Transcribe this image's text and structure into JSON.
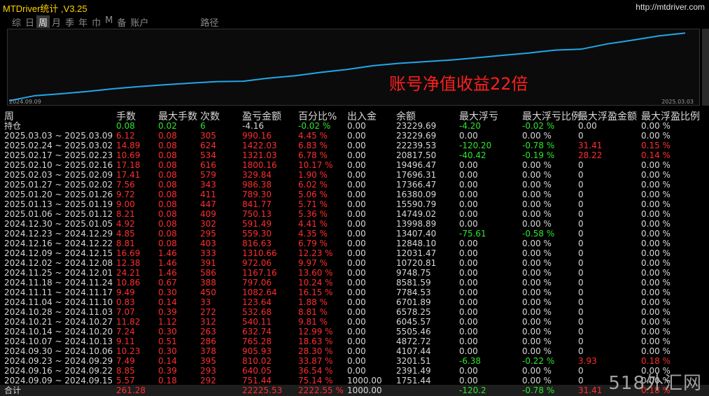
{
  "title": "MTDriver统计 ,V3.25",
  "site": "http://mtdriver.com",
  "tabs": [
    "综",
    "日",
    "周",
    "月",
    "季",
    "年",
    "巾",
    "M",
    "备",
    "账户",
    "路径"
  ],
  "active_tab": 2,
  "annotation": "账号净值收益22倍",
  "chart_data": {
    "type": "line",
    "x_start_label": "2024.09.09",
    "x_end_label": "2025.03.03",
    "series": [
      {
        "values": [
          0,
          1751.44,
          2391.49,
          3201.51,
          4107.44,
          4872.72,
          5505.46,
          6045.57,
          6578.25,
          6701.89,
          7784.53,
          8581.59,
          9748.75,
          10720.81,
          12031.47,
          12848.1,
          13407.4,
          13998.89,
          14749.02,
          15590.79,
          16380.09,
          17366.47,
          17696.31,
          19496.47,
          20817.5,
          22239.53,
          23229.69
        ]
      }
    ],
    "ylim": [
      0,
      24000
    ],
    "line_color": "#1fa8e8"
  },
  "columns": [
    "周",
    "手数",
    "最大手数",
    "次数",
    "盈亏金额",
    "百分比%",
    "出入金",
    "余额",
    "最大浮亏",
    "最大浮亏比例",
    "最大浮盈金额",
    "最大浮盈比例"
  ],
  "rows": [
    {
      "week": "持仓",
      "lots": "0.08",
      "maxlot": "0.02",
      "count": "6",
      "pl": "-4.16",
      "pct": "-0.02 %",
      "io": "0.00",
      "bal": "23229.69",
      "maxdd": "-4.20",
      "maxddp": "-0.02 %",
      "maxfp": "0.00",
      "maxfpp": "0.00 %",
      "color": "green"
    },
    {
      "week": "2025.03.03 ~ 2025.03.09",
      "lots": "6.12",
      "maxlot": "0.08",
      "count": "305",
      "pl": "990.16",
      "pct": "4.45 %",
      "io": "0.00",
      "bal": "23229.69",
      "maxdd": "0.00",
      "maxddp": "0.00 %",
      "maxfp": "0",
      "maxfpp": "0.00 %",
      "color": "red"
    },
    {
      "week": "2025.02.24 ~ 2025.03.02",
      "lots": "14.89",
      "maxlot": "0.08",
      "count": "624",
      "pl": "1422.03",
      "pct": "6.83 %",
      "io": "0.00",
      "bal": "22239.53",
      "maxdd": "-120.20",
      "maxddp": "-0.78 %",
      "maxfp": "31.41",
      "maxfpp": "0.15 %",
      "color": "red"
    },
    {
      "week": "2025.02.17 ~ 2025.02.23",
      "lots": "10.69",
      "maxlot": "0.08",
      "count": "534",
      "pl": "1321.03",
      "pct": "6.78 %",
      "io": "0.00",
      "bal": "20817.50",
      "maxdd": "-40.42",
      "maxddp": "-0.19 %",
      "maxfp": "28.22",
      "maxfpp": "0.14 %",
      "color": "red"
    },
    {
      "week": "2025.02.10 ~ 2025.02.16",
      "lots": "17.18",
      "maxlot": "0.08",
      "count": "616",
      "pl": "1800.16",
      "pct": "10.17 %",
      "io": "0.00",
      "bal": "19496.47",
      "maxdd": "0.00",
      "maxddp": "0.00 %",
      "maxfp": "0",
      "maxfpp": "0.00 %",
      "color": "red"
    },
    {
      "week": "2025.02.03 ~ 2025.02.09",
      "lots": "17.41",
      "maxlot": "0.08",
      "count": "579",
      "pl": "329.84",
      "pct": "1.90 %",
      "io": "0.00",
      "bal": "17696.31",
      "maxdd": "0.00",
      "maxddp": "0.00 %",
      "maxfp": "0",
      "maxfpp": "0.00 %",
      "color": "red"
    },
    {
      "week": "2025.01.27 ~ 2025.02.02",
      "lots": "7.56",
      "maxlot": "0.08",
      "count": "343",
      "pl": "986.38",
      "pct": "6.02 %",
      "io": "0.00",
      "bal": "17366.47",
      "maxdd": "0.00",
      "maxddp": "0.00 %",
      "maxfp": "0",
      "maxfpp": "0.00 %",
      "color": "red"
    },
    {
      "week": "2025.01.20 ~ 2025.01.26",
      "lots": "9.72",
      "maxlot": "0.08",
      "count": "411",
      "pl": "789.30",
      "pct": "5.06 %",
      "io": "0.00",
      "bal": "16380.09",
      "maxdd": "0.00",
      "maxddp": "0.00 %",
      "maxfp": "0",
      "maxfpp": "0.00 %",
      "color": "red"
    },
    {
      "week": "2025.01.13 ~ 2025.01.19",
      "lots": "9.00",
      "maxlot": "0.08",
      "count": "447",
      "pl": "841.77",
      "pct": "5.71 %",
      "io": "0.00",
      "bal": "15590.79",
      "maxdd": "0.00",
      "maxddp": "0.00 %",
      "maxfp": "0",
      "maxfpp": "0.00 %",
      "color": "red"
    },
    {
      "week": "2025.01.06 ~ 2025.01.12",
      "lots": "8.21",
      "maxlot": "0.08",
      "count": "409",
      "pl": "750.13",
      "pct": "5.36 %",
      "io": "0.00",
      "bal": "14749.02",
      "maxdd": "0.00",
      "maxddp": "0.00 %",
      "maxfp": "0",
      "maxfpp": "0.00 %",
      "color": "red"
    },
    {
      "week": "2024.12.30 ~ 2025.01.05",
      "lots": "4.92",
      "maxlot": "0.08",
      "count": "302",
      "pl": "591.49",
      "pct": "4.41 %",
      "io": "0.00",
      "bal": "13998.89",
      "maxdd": "0.00",
      "maxddp": "0.00 %",
      "maxfp": "0",
      "maxfpp": "0.00 %",
      "color": "red"
    },
    {
      "week": "2024.12.23 ~ 2024.12.29",
      "lots": "4.85",
      "maxlot": "0.08",
      "count": "295",
      "pl": "559.30",
      "pct": "4.35 %",
      "io": "0.00",
      "bal": "13407.40",
      "maxdd": "-75.61",
      "maxddp": "-0.58 %",
      "maxfp": "0",
      "maxfpp": "0.00 %",
      "color": "red"
    },
    {
      "week": "2024.12.16 ~ 2024.12.22",
      "lots": "8.81",
      "maxlot": "0.08",
      "count": "403",
      "pl": "816.63",
      "pct": "6.79 %",
      "io": "0.00",
      "bal": "12848.10",
      "maxdd": "0.00",
      "maxddp": "0.00 %",
      "maxfp": "0",
      "maxfpp": "0.00 %",
      "color": "red"
    },
    {
      "week": "2024.12.09 ~ 2024.12.15",
      "lots": "16.69",
      "maxlot": "1.46",
      "count": "333",
      "pl": "1310.66",
      "pct": "12.23 %",
      "io": "0.00",
      "bal": "12031.47",
      "maxdd": "0.00",
      "maxddp": "0.00 %",
      "maxfp": "0",
      "maxfpp": "0.00 %",
      "color": "red"
    },
    {
      "week": "2024.12.02 ~ 2024.12.08",
      "lots": "12.38",
      "maxlot": "1.46",
      "count": "391",
      "pl": "972.06",
      "pct": "9.97 %",
      "io": "0.00",
      "bal": "10720.81",
      "maxdd": "0.00",
      "maxddp": "0.00 %",
      "maxfp": "0",
      "maxfpp": "0.00 %",
      "color": "red"
    },
    {
      "week": "2024.11.25 ~ 2024.12.01",
      "lots": "24.21",
      "maxlot": "1.46",
      "count": "586",
      "pl": "1167.16",
      "pct": "13.60 %",
      "io": "0.00",
      "bal": "9748.75",
      "maxdd": "0.00",
      "maxddp": "0.00 %",
      "maxfp": "0",
      "maxfpp": "0.00 %",
      "color": "red"
    },
    {
      "week": "2024.11.18 ~ 2024.11.24",
      "lots": "10.86",
      "maxlot": "0.67",
      "count": "388",
      "pl": "797.06",
      "pct": "10.24 %",
      "io": "0.00",
      "bal": "8581.59",
      "maxdd": "0.00",
      "maxddp": "0.00 %",
      "maxfp": "0",
      "maxfpp": "0.00 %",
      "color": "red"
    },
    {
      "week": "2024.11.11 ~ 2024.11.17",
      "lots": "9.49",
      "maxlot": "0.30",
      "count": "450",
      "pl": "1082.64",
      "pct": "16.15 %",
      "io": "0.00",
      "bal": "7784.53",
      "maxdd": "0.00",
      "maxddp": "0.00 %",
      "maxfp": "0",
      "maxfpp": "0.00 %",
      "color": "red"
    },
    {
      "week": "2024.11.04 ~ 2024.11.10",
      "lots": "0.83",
      "maxlot": "0.14",
      "count": "33",
      "pl": "123.64",
      "pct": "1.88 %",
      "io": "0.00",
      "bal": "6701.89",
      "maxdd": "0.00",
      "maxddp": "0.00 %",
      "maxfp": "0",
      "maxfpp": "0.00 %",
      "color": "red"
    },
    {
      "week": "2024.10.28 ~ 2024.11.03",
      "lots": "7.07",
      "maxlot": "0.39",
      "count": "272",
      "pl": "532.68",
      "pct": "8.81 %",
      "io": "0.00",
      "bal": "6578.25",
      "maxdd": "0.00",
      "maxddp": "0.00 %",
      "maxfp": "0",
      "maxfpp": "0.00 %",
      "color": "red"
    },
    {
      "week": "2024.10.21 ~ 2024.10.27",
      "lots": "11.82",
      "maxlot": "1.12",
      "count": "312",
      "pl": "540.11",
      "pct": "9.81 %",
      "io": "0.00",
      "bal": "6045.57",
      "maxdd": "0.00",
      "maxddp": "0.00 %",
      "maxfp": "0",
      "maxfpp": "0.00 %",
      "color": "red"
    },
    {
      "week": "2024.10.14 ~ 2024.10.20",
      "lots": "7.24",
      "maxlot": "0.30",
      "count": "263",
      "pl": "632.74",
      "pct": "12.99 %",
      "io": "0.00",
      "bal": "5505.46",
      "maxdd": "0.00",
      "maxddp": "0.00 %",
      "maxfp": "0",
      "maxfpp": "0.00 %",
      "color": "red"
    },
    {
      "week": "2024.10.07 ~ 2024.10.13",
      "lots": "9.11",
      "maxlot": "0.51",
      "count": "286",
      "pl": "765.28",
      "pct": "18.63 %",
      "io": "0.00",
      "bal": "4872.72",
      "maxdd": "0.00",
      "maxddp": "0.00 %",
      "maxfp": "0",
      "maxfpp": "0.00 %",
      "color": "red"
    },
    {
      "week": "2024.09.30 ~ 2024.10.06",
      "lots": "10.23",
      "maxlot": "0.30",
      "count": "378",
      "pl": "905.93",
      "pct": "28.30 %",
      "io": "0.00",
      "bal": "4107.44",
      "maxdd": "0.00",
      "maxddp": "0.00 %",
      "maxfp": "0",
      "maxfpp": "0.00 %",
      "color": "red"
    },
    {
      "week": "2024.09.23 ~ 2024.09.29",
      "lots": "7.49",
      "maxlot": "0.14",
      "count": "395",
      "pl": "810.02",
      "pct": "33.87 %",
      "io": "0.00",
      "bal": "3201.51",
      "maxdd": "-6.38",
      "maxddp": "-0.22 %",
      "maxfp": "3.93",
      "maxfpp": "0.18 %",
      "color": "red"
    },
    {
      "week": "2024.09.16 ~ 2024.09.22",
      "lots": "8.85",
      "maxlot": "0.39",
      "count": "293",
      "pl": "640.05",
      "pct": "36.54 %",
      "io": "0.00",
      "bal": "2391.49",
      "maxdd": "0.00",
      "maxddp": "0.00 %",
      "maxfp": "0",
      "maxfpp": "0.00 %",
      "color": "red"
    },
    {
      "week": "2024.09.09 ~ 2024.09.15",
      "lots": "5.57",
      "maxlot": "0.18",
      "count": "292",
      "pl": "751.44",
      "pct": "75.14 %",
      "io": "1000.00",
      "bal": "1751.44",
      "maxdd": "0.00",
      "maxddp": "0.00 %",
      "maxfp": "0",
      "maxfpp": "0.00 %",
      "color": "red"
    }
  ],
  "total": {
    "week": "合计",
    "lots": "261.28",
    "pl": "22225.53",
    "pct": "2222.55 %",
    "io": "1000.00",
    "maxdd": "-120.2",
    "maxddp": "-0.78 %",
    "maxfp": "31.41",
    "maxfpp": "0.18 %"
  },
  "watermark": "518外汇网"
}
